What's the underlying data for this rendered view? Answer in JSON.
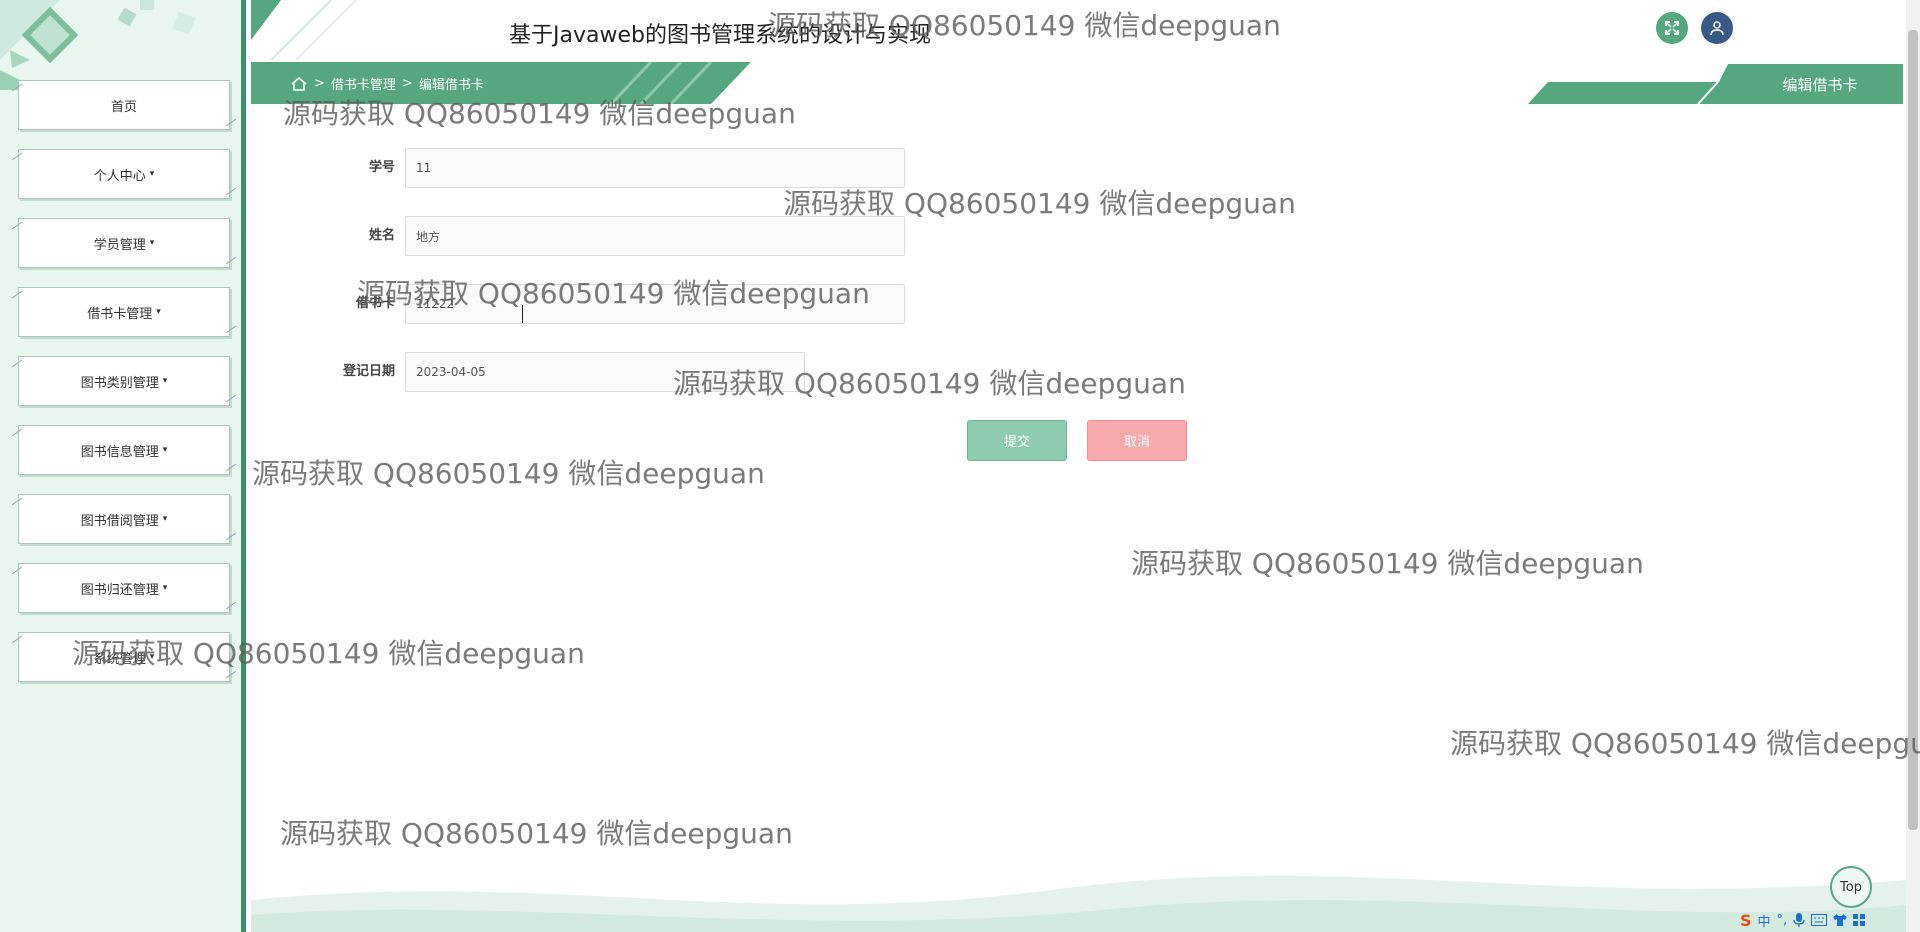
{
  "header": {
    "title": "基于Javaweb的图书管理系统的设计与实现",
    "fullscreen_icon": "expand-icon",
    "user_icon": "user-icon"
  },
  "sidebar": {
    "items": [
      {
        "label": "首页",
        "caret": ""
      },
      {
        "label": "个人中心",
        "caret": "▾"
      },
      {
        "label": "学员管理",
        "caret": "▾"
      },
      {
        "label": "借书卡管理",
        "caret": "▾"
      },
      {
        "label": "图书类别管理",
        "caret": "▾"
      },
      {
        "label": "图书信息管理",
        "caret": "▾"
      },
      {
        "label": "图书借阅管理",
        "caret": "▾"
      },
      {
        "label": "图书归还管理",
        "caret": "▾"
      },
      {
        "label": "系统管理",
        "caret": "▾"
      }
    ]
  },
  "breadcrumb": {
    "home_icon": "home-icon",
    "sep": ">",
    "items": [
      "借书卡管理",
      "编辑借书卡"
    ]
  },
  "page_tab": {
    "label": "编辑借书卡"
  },
  "form": {
    "fields": [
      {
        "label": "学号",
        "value": "11"
      },
      {
        "label": "姓名",
        "value": "地方"
      },
      {
        "label": "借书卡",
        "value": "11222"
      },
      {
        "label": "登记日期",
        "value": "2023-04-05"
      }
    ],
    "submit_label": "提交",
    "cancel_label": "取消"
  },
  "top_button": {
    "label": "Top"
  },
  "ime_tray": {
    "logo": "S",
    "lang": "中",
    "punct": "°,",
    "icons": [
      "microphone-icon",
      "keyboard-icon",
      "shirt-icon",
      "grid-icon"
    ]
  },
  "watermark": {
    "text": "源码获取 QQ86050149 微信deepguan"
  },
  "colors": {
    "accent": "#56a77f",
    "sidebar_bg": "#e8f6ef",
    "submit": "#8fcbb0",
    "cancel": "#f7a9ad"
  }
}
